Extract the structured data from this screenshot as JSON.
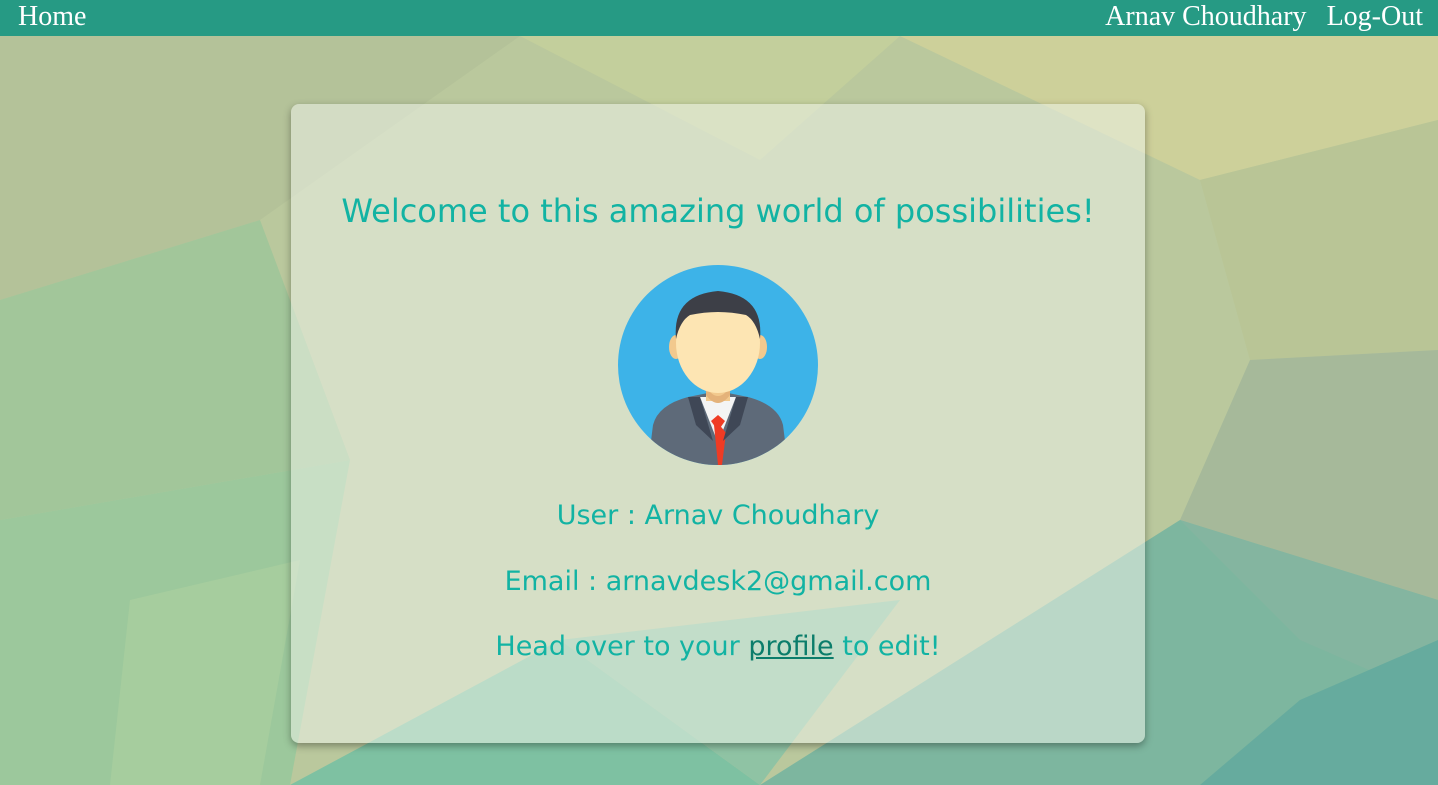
{
  "navbar": {
    "home_label": "Home",
    "user_name": "Arnav Choudhary",
    "logout_label": "Log-Out"
  },
  "card": {
    "welcome": "Welcome to this amazing world of possibilities!",
    "user_line": "User : Arnav Choudhary",
    "email_line": "Email : arnavdesk2@gmail.com",
    "profile_prefix": "Head over to your ",
    "profile_link": "profile",
    "profile_suffix": " to edit!",
    "avatar_icon": "businessman-avatar-icon"
  },
  "colors": {
    "navbar": "#269a84",
    "text_accent": "#12b3a3",
    "link": "#0b7d6b"
  }
}
